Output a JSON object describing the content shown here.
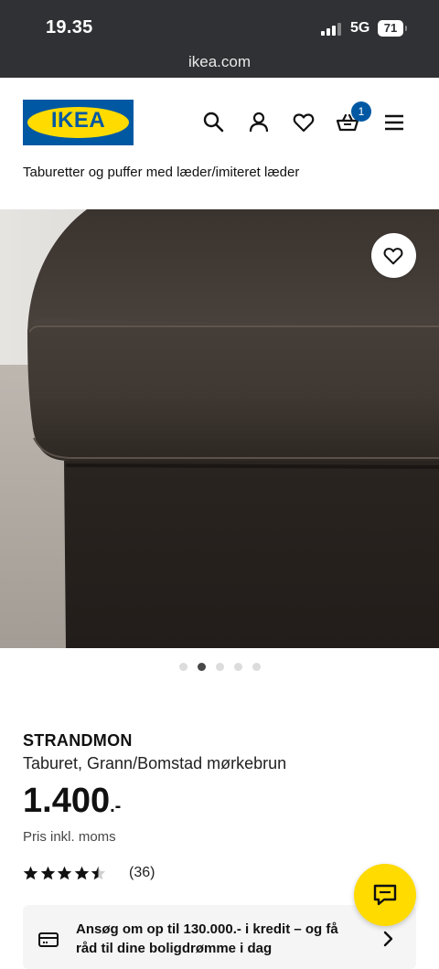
{
  "status_bar": {
    "time": "19.35",
    "network": "5G",
    "battery": "71",
    "url": "ikea.com"
  },
  "header": {
    "logo_text": "IKEA",
    "icons": [
      "search-icon",
      "profile-icon",
      "heart-icon",
      "cart-icon",
      "menu-icon"
    ],
    "cart_count": "1",
    "brand_colors": {
      "blue": "#0058a3",
      "yellow": "#ffdb00"
    }
  },
  "breadcrumb": "Taburetter og puffer med læder/imiteret læder",
  "gallery": {
    "image_count": 5,
    "active_index": 1
  },
  "product": {
    "name": "STRANDMON",
    "description": "Taburet, Grann/Bomstad mørkebrun",
    "price": "1.400",
    "price_suffix": ".-",
    "price_note": "Pris inkl. moms",
    "rating_value": 4.5,
    "rating_max": 5,
    "review_count": "(36)"
  },
  "credit_banner": {
    "text": "Ansøg om op til 130.000.- i kredit – og få råd til dine boligdrømme i dag"
  }
}
